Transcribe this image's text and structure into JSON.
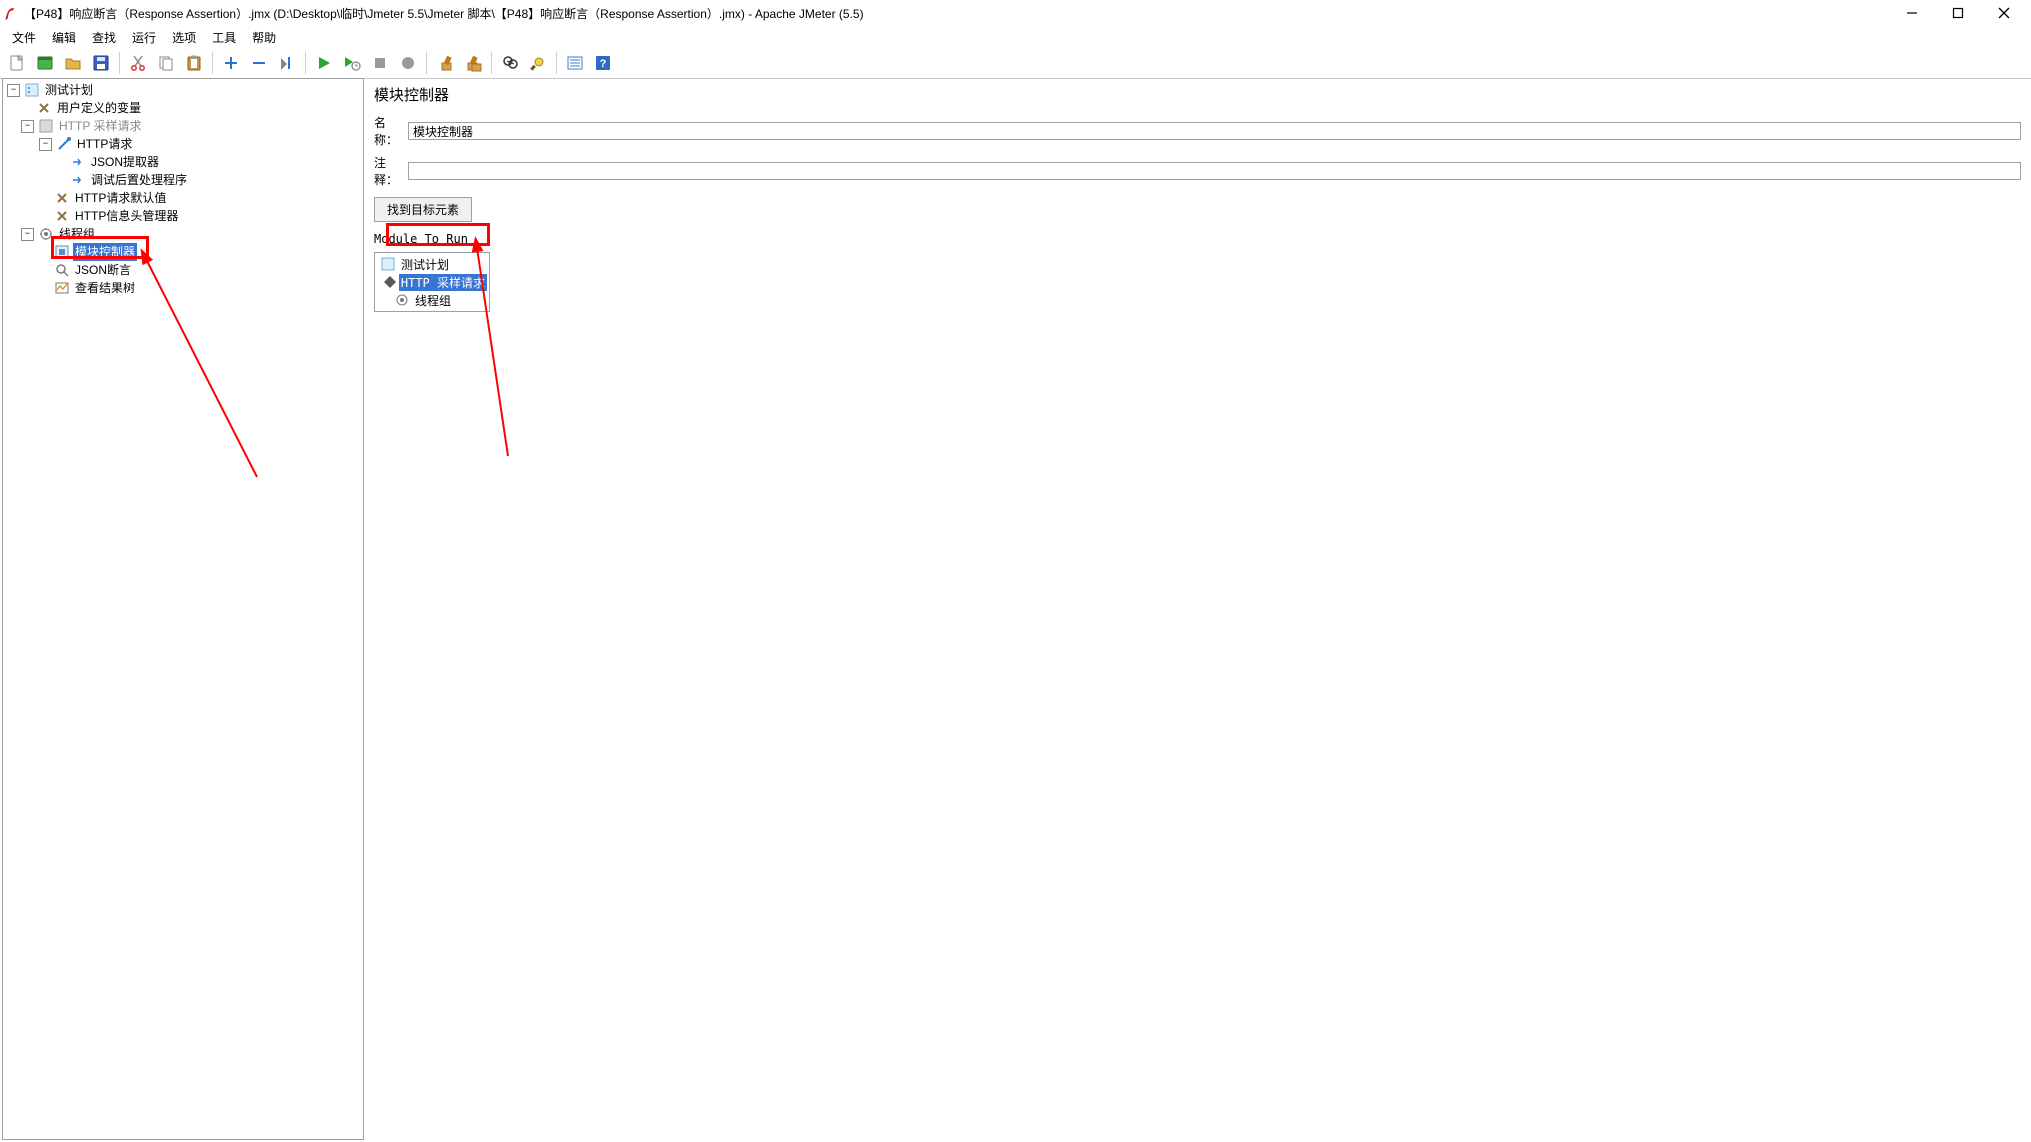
{
  "window": {
    "title": "【P48】响应断言（Response Assertion）.jmx (D:\\Desktop\\临时\\Jmeter 5.5\\Jmeter 脚本\\【P48】响应断言（Response Assertion）.jmx) - Apache JMeter (5.5)"
  },
  "menu": {
    "file": "文件",
    "edit": "编辑",
    "search": "查找",
    "run": "运行",
    "options": "选项",
    "tools": "工具",
    "help": "帮助"
  },
  "toolbar_icons": {
    "new": "new-file-icon",
    "templates": "templates-icon",
    "open": "open-icon",
    "save": "save-icon",
    "cut": "cut-icon",
    "copy": "copy-icon",
    "paste": "paste-icon",
    "expand": "expand-plus-icon",
    "collapse": "collapse-minus-icon",
    "toggle": "toggle-icon",
    "start": "start-icon",
    "start_no_timers": "start-no-timers-icon",
    "stop": "stop-icon",
    "shutdown": "shutdown-icon",
    "clear": "clear-icon",
    "clear_all": "clear-all-icon",
    "search_tb": "search-icon",
    "reset_search": "reset-search-icon",
    "function_helper": "function-helper-icon",
    "help": "help-icon"
  },
  "tree": {
    "plan": "测试计划",
    "user_vars": "用户定义的变量",
    "http_sampler_disabled": "HTTP 采样请求",
    "http_request": "HTTP请求",
    "json_extractor": "JSON提取器",
    "debug_post": "调试后置处理程序",
    "http_defaults": "HTTP请求默认值",
    "http_headers": "HTTP信息头管理器",
    "thread_group": "线程组",
    "module_controller": "模块控制器",
    "json_assertion": "JSON断言",
    "view_results_tree": "查看结果树"
  },
  "content": {
    "panel_title": "模块控制器",
    "name_label": "名称：",
    "name_value": "模块控制器",
    "comments_label": "注释：",
    "comments_value": "",
    "find_button": "找到目标元素",
    "module_to_run": "Module To Run"
  },
  "module_tree": {
    "plan": "测试计划",
    "http_sampler": "HTTP 采样请求",
    "thread_group": "线程组"
  }
}
